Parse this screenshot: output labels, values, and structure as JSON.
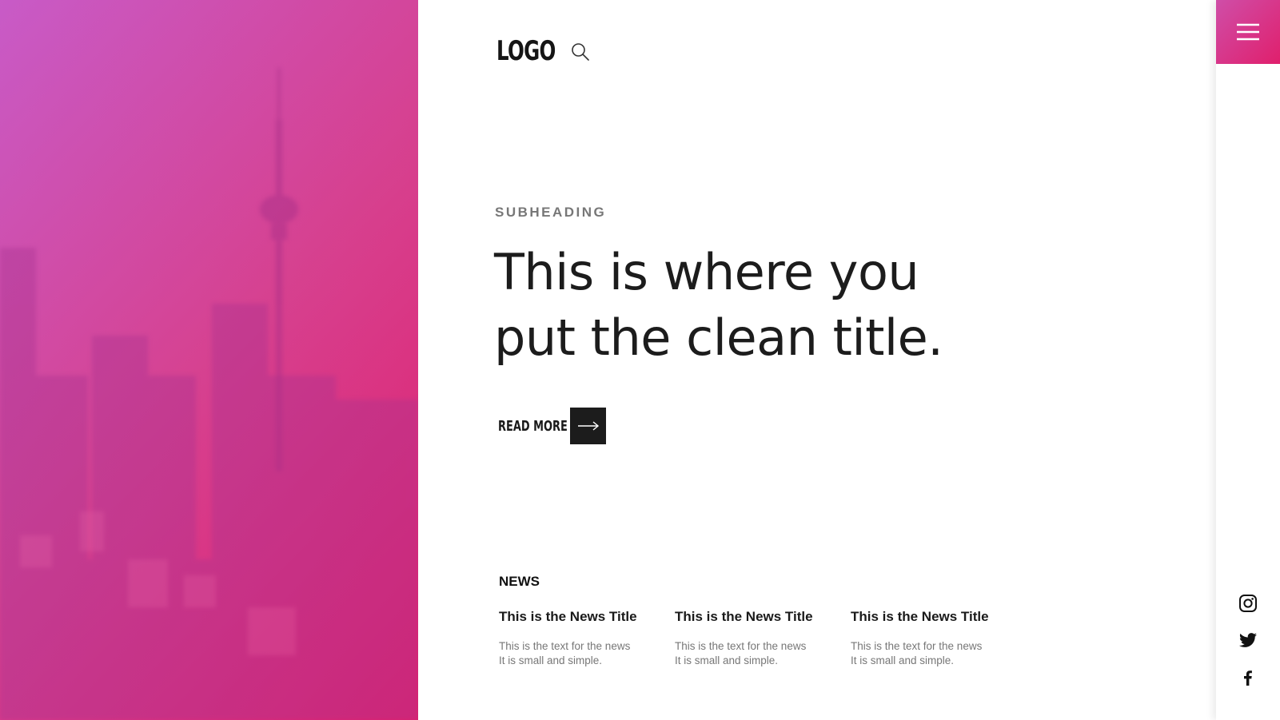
{
  "colors": {
    "accent_start": "#c85bc7",
    "accent_end": "#e01f6c",
    "text_dark": "#1c1c1c",
    "text_muted": "#777777"
  },
  "header": {
    "logo_text": "LOGO",
    "search_icon": "search-icon"
  },
  "hero": {
    "image_icon": "city-skyline-image",
    "subheading": "SUBHEADING",
    "title": "This is where you put the clean title.",
    "read_more_label": "READ MORE",
    "read_more_icon": "arrow-right-icon"
  },
  "news": {
    "heading": "NEWS",
    "items": [
      {
        "title": "This is the News Title",
        "text_line1": "This is the text for  the news",
        "text_line2": "It is small and simple."
      },
      {
        "title": "This is the News Title",
        "text_line1": "This is the text for  the news",
        "text_line2": "It is small and simple."
      },
      {
        "title": "This is the News Title",
        "text_line1": "This is the text for  the news",
        "text_line2": "It is small and simple."
      }
    ]
  },
  "side_rail": {
    "menu_icon": "hamburger-menu-icon",
    "social": [
      "instagram-icon",
      "twitter-icon",
      "facebook-icon"
    ]
  }
}
